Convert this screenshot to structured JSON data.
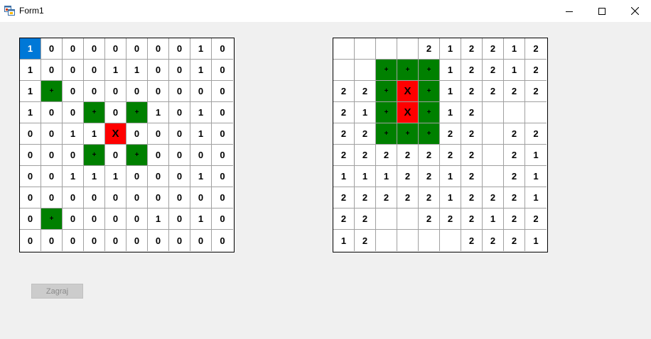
{
  "window": {
    "title": "Form1",
    "minimize_glyph": "—",
    "maximize_glyph": "☐",
    "close_glyph": "✕"
  },
  "play_button": {
    "label": "Zagraj",
    "enabled": false
  },
  "colors": {
    "hit": "#008000",
    "ship": "#ff0000",
    "selected": "#0078d7"
  },
  "left_board": {
    "selected_cell": [
      0,
      0
    ],
    "cells": [
      [
        {
          "t": "1",
          "c": "sel"
        },
        {
          "t": "0"
        },
        {
          "t": "0"
        },
        {
          "t": "0"
        },
        {
          "t": "0"
        },
        {
          "t": "0"
        },
        {
          "t": "0"
        },
        {
          "t": "0"
        },
        {
          "t": "1"
        },
        {
          "t": "0"
        }
      ],
      [
        {
          "t": "1"
        },
        {
          "t": "0"
        },
        {
          "t": "0"
        },
        {
          "t": "0"
        },
        {
          "t": "1"
        },
        {
          "t": "1"
        },
        {
          "t": "0"
        },
        {
          "t": "0"
        },
        {
          "t": "1"
        },
        {
          "t": "0"
        }
      ],
      [
        {
          "t": "1"
        },
        {
          "t": "+",
          "c": "g"
        },
        {
          "t": "0"
        },
        {
          "t": "0"
        },
        {
          "t": "0"
        },
        {
          "t": "0"
        },
        {
          "t": "0"
        },
        {
          "t": "0"
        },
        {
          "t": "0"
        },
        {
          "t": "0"
        }
      ],
      [
        {
          "t": "1"
        },
        {
          "t": "0"
        },
        {
          "t": "0"
        },
        {
          "t": "+",
          "c": "g"
        },
        {
          "t": "0"
        },
        {
          "t": "+",
          "c": "g"
        },
        {
          "t": "1"
        },
        {
          "t": "0"
        },
        {
          "t": "1"
        },
        {
          "t": "0"
        }
      ],
      [
        {
          "t": "0"
        },
        {
          "t": "0"
        },
        {
          "t": "1"
        },
        {
          "t": "1"
        },
        {
          "t": "X",
          "c": "r"
        },
        {
          "t": "0"
        },
        {
          "t": "0"
        },
        {
          "t": "0"
        },
        {
          "t": "1"
        },
        {
          "t": "0"
        }
      ],
      [
        {
          "t": "0"
        },
        {
          "t": "0"
        },
        {
          "t": "0"
        },
        {
          "t": "+",
          "c": "g"
        },
        {
          "t": "0"
        },
        {
          "t": "+",
          "c": "g"
        },
        {
          "t": "0"
        },
        {
          "t": "0"
        },
        {
          "t": "0"
        },
        {
          "t": "0"
        }
      ],
      [
        {
          "t": "0"
        },
        {
          "t": "0"
        },
        {
          "t": "1"
        },
        {
          "t": "1"
        },
        {
          "t": "1"
        },
        {
          "t": "0"
        },
        {
          "t": "0"
        },
        {
          "t": "0"
        },
        {
          "t": "1"
        },
        {
          "t": "0"
        }
      ],
      [
        {
          "t": "0"
        },
        {
          "t": "0"
        },
        {
          "t": "0"
        },
        {
          "t": "0"
        },
        {
          "t": "0"
        },
        {
          "t": "0"
        },
        {
          "t": "0"
        },
        {
          "t": "0"
        },
        {
          "t": "0"
        },
        {
          "t": "0"
        }
      ],
      [
        {
          "t": "0"
        },
        {
          "t": "+",
          "c": "g"
        },
        {
          "t": "0"
        },
        {
          "t": "0"
        },
        {
          "t": "0"
        },
        {
          "t": "0"
        },
        {
          "t": "1"
        },
        {
          "t": "0"
        },
        {
          "t": "1"
        },
        {
          "t": "0"
        }
      ],
      [
        {
          "t": "0"
        },
        {
          "t": "0"
        },
        {
          "t": "0"
        },
        {
          "t": "0"
        },
        {
          "t": "0"
        },
        {
          "t": "0"
        },
        {
          "t": "0"
        },
        {
          "t": "0"
        },
        {
          "t": "0"
        },
        {
          "t": "0"
        }
      ]
    ]
  },
  "right_board": {
    "cells": [
      [
        {
          "t": ""
        },
        {
          "t": ""
        },
        {
          "t": ""
        },
        {
          "t": ""
        },
        {
          "t": "2"
        },
        {
          "t": "1"
        },
        {
          "t": "2"
        },
        {
          "t": "2"
        },
        {
          "t": "1"
        },
        {
          "t": "2"
        }
      ],
      [
        {
          "t": ""
        },
        {
          "t": ""
        },
        {
          "t": "+",
          "c": "g"
        },
        {
          "t": "+",
          "c": "g"
        },
        {
          "t": "+",
          "c": "g"
        },
        {
          "t": "1"
        },
        {
          "t": "2"
        },
        {
          "t": "2"
        },
        {
          "t": "1"
        },
        {
          "t": "2"
        }
      ],
      [
        {
          "t": "2"
        },
        {
          "t": "2"
        },
        {
          "t": "+",
          "c": "g"
        },
        {
          "t": "X",
          "c": "r"
        },
        {
          "t": "+",
          "c": "g"
        },
        {
          "t": "1"
        },
        {
          "t": "2"
        },
        {
          "t": "2"
        },
        {
          "t": "2"
        },
        {
          "t": "2"
        }
      ],
      [
        {
          "t": "2"
        },
        {
          "t": "1"
        },
        {
          "t": "+",
          "c": "g"
        },
        {
          "t": "X",
          "c": "r"
        },
        {
          "t": "+",
          "c": "g"
        },
        {
          "t": "1"
        },
        {
          "t": "2"
        },
        {
          "t": ""
        },
        {
          "t": ""
        },
        {
          "t": ""
        }
      ],
      [
        {
          "t": "2"
        },
        {
          "t": "2"
        },
        {
          "t": "+",
          "c": "g"
        },
        {
          "t": "+",
          "c": "g"
        },
        {
          "t": "+",
          "c": "g"
        },
        {
          "t": "2"
        },
        {
          "t": "2"
        },
        {
          "t": ""
        },
        {
          "t": "2"
        },
        {
          "t": "2"
        }
      ],
      [
        {
          "t": "2"
        },
        {
          "t": "2"
        },
        {
          "t": "2"
        },
        {
          "t": "2"
        },
        {
          "t": "2"
        },
        {
          "t": "2"
        },
        {
          "t": "2"
        },
        {
          "t": ""
        },
        {
          "t": "2"
        },
        {
          "t": "1"
        }
      ],
      [
        {
          "t": "1"
        },
        {
          "t": "1"
        },
        {
          "t": "1"
        },
        {
          "t": "2"
        },
        {
          "t": "2"
        },
        {
          "t": "1"
        },
        {
          "t": "2"
        },
        {
          "t": ""
        },
        {
          "t": "2"
        },
        {
          "t": "1"
        }
      ],
      [
        {
          "t": "2"
        },
        {
          "t": "2"
        },
        {
          "t": "2"
        },
        {
          "t": "2"
        },
        {
          "t": "2"
        },
        {
          "t": "1"
        },
        {
          "t": "2"
        },
        {
          "t": "2"
        },
        {
          "t": "2"
        },
        {
          "t": "1"
        }
      ],
      [
        {
          "t": "2"
        },
        {
          "t": "2"
        },
        {
          "t": ""
        },
        {
          "t": ""
        },
        {
          "t": "2"
        },
        {
          "t": "2"
        },
        {
          "t": "2"
        },
        {
          "t": "1"
        },
        {
          "t": "2"
        },
        {
          "t": "2"
        }
      ],
      [
        {
          "t": "1"
        },
        {
          "t": "2"
        },
        {
          "t": ""
        },
        {
          "t": ""
        },
        {
          "t": ""
        },
        {
          "t": ""
        },
        {
          "t": "2"
        },
        {
          "t": "2"
        },
        {
          "t": "2"
        },
        {
          "t": "1"
        }
      ]
    ]
  }
}
